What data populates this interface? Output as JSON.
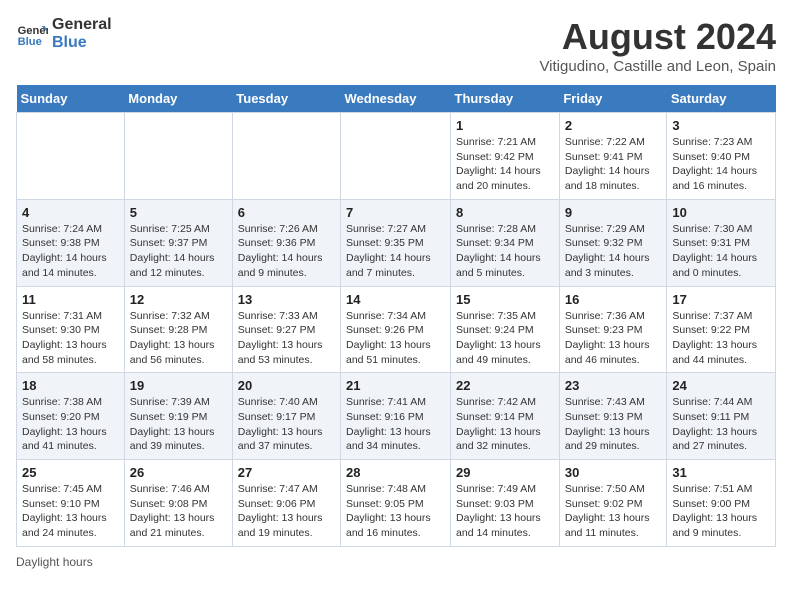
{
  "logo": {
    "line1": "General",
    "line2": "Blue"
  },
  "title": "August 2024",
  "subtitle": "Vitigudino, Castille and Leon, Spain",
  "days_of_week": [
    "Sunday",
    "Monday",
    "Tuesday",
    "Wednesday",
    "Thursday",
    "Friday",
    "Saturday"
  ],
  "weeks": [
    [
      {
        "day": "",
        "info": ""
      },
      {
        "day": "",
        "info": ""
      },
      {
        "day": "",
        "info": ""
      },
      {
        "day": "",
        "info": ""
      },
      {
        "day": "1",
        "sunrise": "7:21 AM",
        "sunset": "9:42 PM",
        "daylight": "14 hours and 20 minutes."
      },
      {
        "day": "2",
        "sunrise": "7:22 AM",
        "sunset": "9:41 PM",
        "daylight": "14 hours and 18 minutes."
      },
      {
        "day": "3",
        "sunrise": "7:23 AM",
        "sunset": "9:40 PM",
        "daylight": "14 hours and 16 minutes."
      }
    ],
    [
      {
        "day": "4",
        "sunrise": "7:24 AM",
        "sunset": "9:38 PM",
        "daylight": "14 hours and 14 minutes."
      },
      {
        "day": "5",
        "sunrise": "7:25 AM",
        "sunset": "9:37 PM",
        "daylight": "14 hours and 12 minutes."
      },
      {
        "day": "6",
        "sunrise": "7:26 AM",
        "sunset": "9:36 PM",
        "daylight": "14 hours and 9 minutes."
      },
      {
        "day": "7",
        "sunrise": "7:27 AM",
        "sunset": "9:35 PM",
        "daylight": "14 hours and 7 minutes."
      },
      {
        "day": "8",
        "sunrise": "7:28 AM",
        "sunset": "9:34 PM",
        "daylight": "14 hours and 5 minutes."
      },
      {
        "day": "9",
        "sunrise": "7:29 AM",
        "sunset": "9:32 PM",
        "daylight": "14 hours and 3 minutes."
      },
      {
        "day": "10",
        "sunrise": "7:30 AM",
        "sunset": "9:31 PM",
        "daylight": "14 hours and 0 minutes."
      }
    ],
    [
      {
        "day": "11",
        "sunrise": "7:31 AM",
        "sunset": "9:30 PM",
        "daylight": "13 hours and 58 minutes."
      },
      {
        "day": "12",
        "sunrise": "7:32 AM",
        "sunset": "9:28 PM",
        "daylight": "13 hours and 56 minutes."
      },
      {
        "day": "13",
        "sunrise": "7:33 AM",
        "sunset": "9:27 PM",
        "daylight": "13 hours and 53 minutes."
      },
      {
        "day": "14",
        "sunrise": "7:34 AM",
        "sunset": "9:26 PM",
        "daylight": "13 hours and 51 minutes."
      },
      {
        "day": "15",
        "sunrise": "7:35 AM",
        "sunset": "9:24 PM",
        "daylight": "13 hours and 49 minutes."
      },
      {
        "day": "16",
        "sunrise": "7:36 AM",
        "sunset": "9:23 PM",
        "daylight": "13 hours and 46 minutes."
      },
      {
        "day": "17",
        "sunrise": "7:37 AM",
        "sunset": "9:22 PM",
        "daylight": "13 hours and 44 minutes."
      }
    ],
    [
      {
        "day": "18",
        "sunrise": "7:38 AM",
        "sunset": "9:20 PM",
        "daylight": "13 hours and 41 minutes."
      },
      {
        "day": "19",
        "sunrise": "7:39 AM",
        "sunset": "9:19 PM",
        "daylight": "13 hours and 39 minutes."
      },
      {
        "day": "20",
        "sunrise": "7:40 AM",
        "sunset": "9:17 PM",
        "daylight": "13 hours and 37 minutes."
      },
      {
        "day": "21",
        "sunrise": "7:41 AM",
        "sunset": "9:16 PM",
        "daylight": "13 hours and 34 minutes."
      },
      {
        "day": "22",
        "sunrise": "7:42 AM",
        "sunset": "9:14 PM",
        "daylight": "13 hours and 32 minutes."
      },
      {
        "day": "23",
        "sunrise": "7:43 AM",
        "sunset": "9:13 PM",
        "daylight": "13 hours and 29 minutes."
      },
      {
        "day": "24",
        "sunrise": "7:44 AM",
        "sunset": "9:11 PM",
        "daylight": "13 hours and 27 minutes."
      }
    ],
    [
      {
        "day": "25",
        "sunrise": "7:45 AM",
        "sunset": "9:10 PM",
        "daylight": "13 hours and 24 minutes."
      },
      {
        "day": "26",
        "sunrise": "7:46 AM",
        "sunset": "9:08 PM",
        "daylight": "13 hours and 21 minutes."
      },
      {
        "day": "27",
        "sunrise": "7:47 AM",
        "sunset": "9:06 PM",
        "daylight": "13 hours and 19 minutes."
      },
      {
        "day": "28",
        "sunrise": "7:48 AM",
        "sunset": "9:05 PM",
        "daylight": "13 hours and 16 minutes."
      },
      {
        "day": "29",
        "sunrise": "7:49 AM",
        "sunset": "9:03 PM",
        "daylight": "13 hours and 14 minutes."
      },
      {
        "day": "30",
        "sunrise": "7:50 AM",
        "sunset": "9:02 PM",
        "daylight": "13 hours and 11 minutes."
      },
      {
        "day": "31",
        "sunrise": "7:51 AM",
        "sunset": "9:00 PM",
        "daylight": "13 hours and 9 minutes."
      }
    ]
  ],
  "footer": "Daylight hours"
}
